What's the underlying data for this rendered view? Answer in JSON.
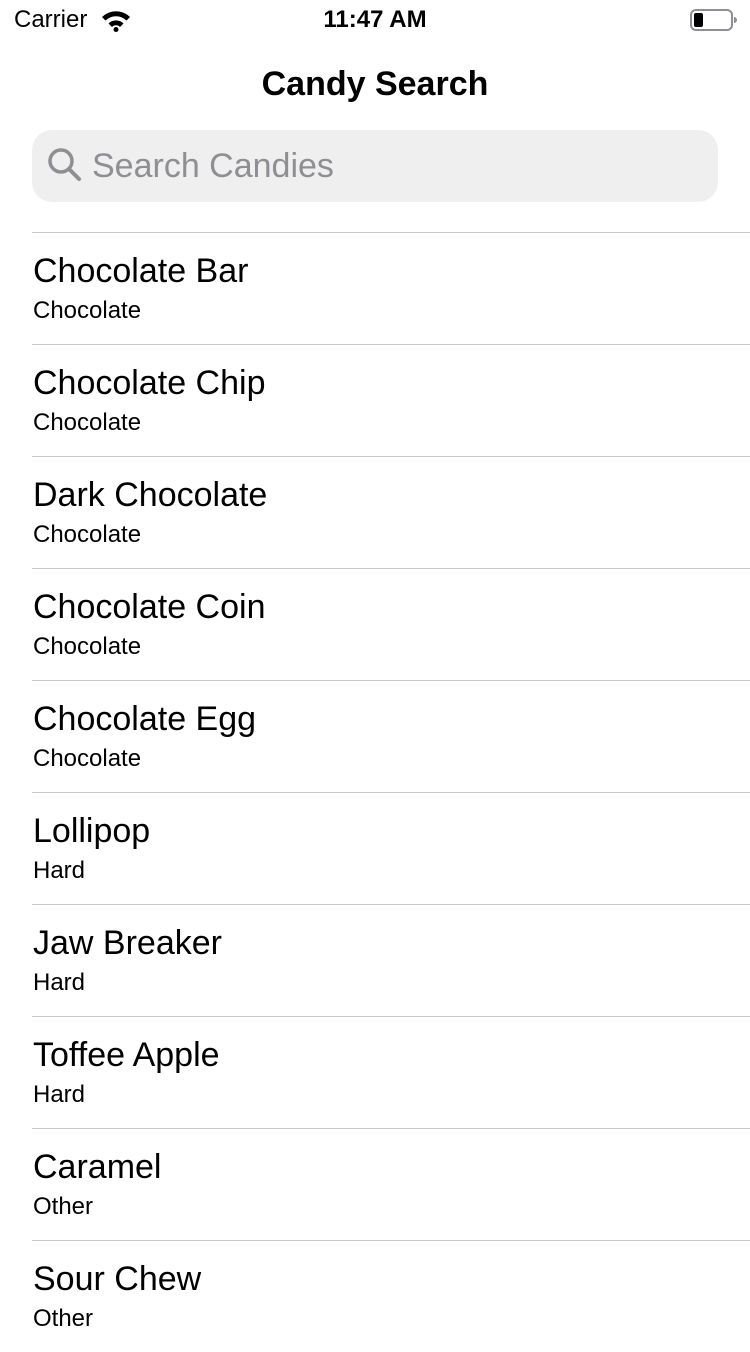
{
  "status_bar": {
    "carrier": "Carrier",
    "time": "11:47 AM"
  },
  "nav": {
    "title": "Candy Search"
  },
  "search": {
    "placeholder": "Search Candies",
    "value": ""
  },
  "candies": [
    {
      "name": "Chocolate Bar",
      "category": "Chocolate"
    },
    {
      "name": "Chocolate Chip",
      "category": "Chocolate"
    },
    {
      "name": "Dark Chocolate",
      "category": "Chocolate"
    },
    {
      "name": "Chocolate Coin",
      "category": "Chocolate"
    },
    {
      "name": "Chocolate Egg",
      "category": "Chocolate"
    },
    {
      "name": "Lollipop",
      "category": "Hard"
    },
    {
      "name": "Jaw Breaker",
      "category": "Hard"
    },
    {
      "name": "Toffee Apple",
      "category": "Hard"
    },
    {
      "name": "Caramel",
      "category": "Other"
    },
    {
      "name": "Sour Chew",
      "category": "Other"
    }
  ],
  "icons": {
    "wifi": "wifi-icon",
    "battery": "battery-icon",
    "search": "search-icon"
  },
  "colors": {
    "search_background": "#efeff0",
    "placeholder": "#8e8e93",
    "separator": "#c8c7cc"
  }
}
